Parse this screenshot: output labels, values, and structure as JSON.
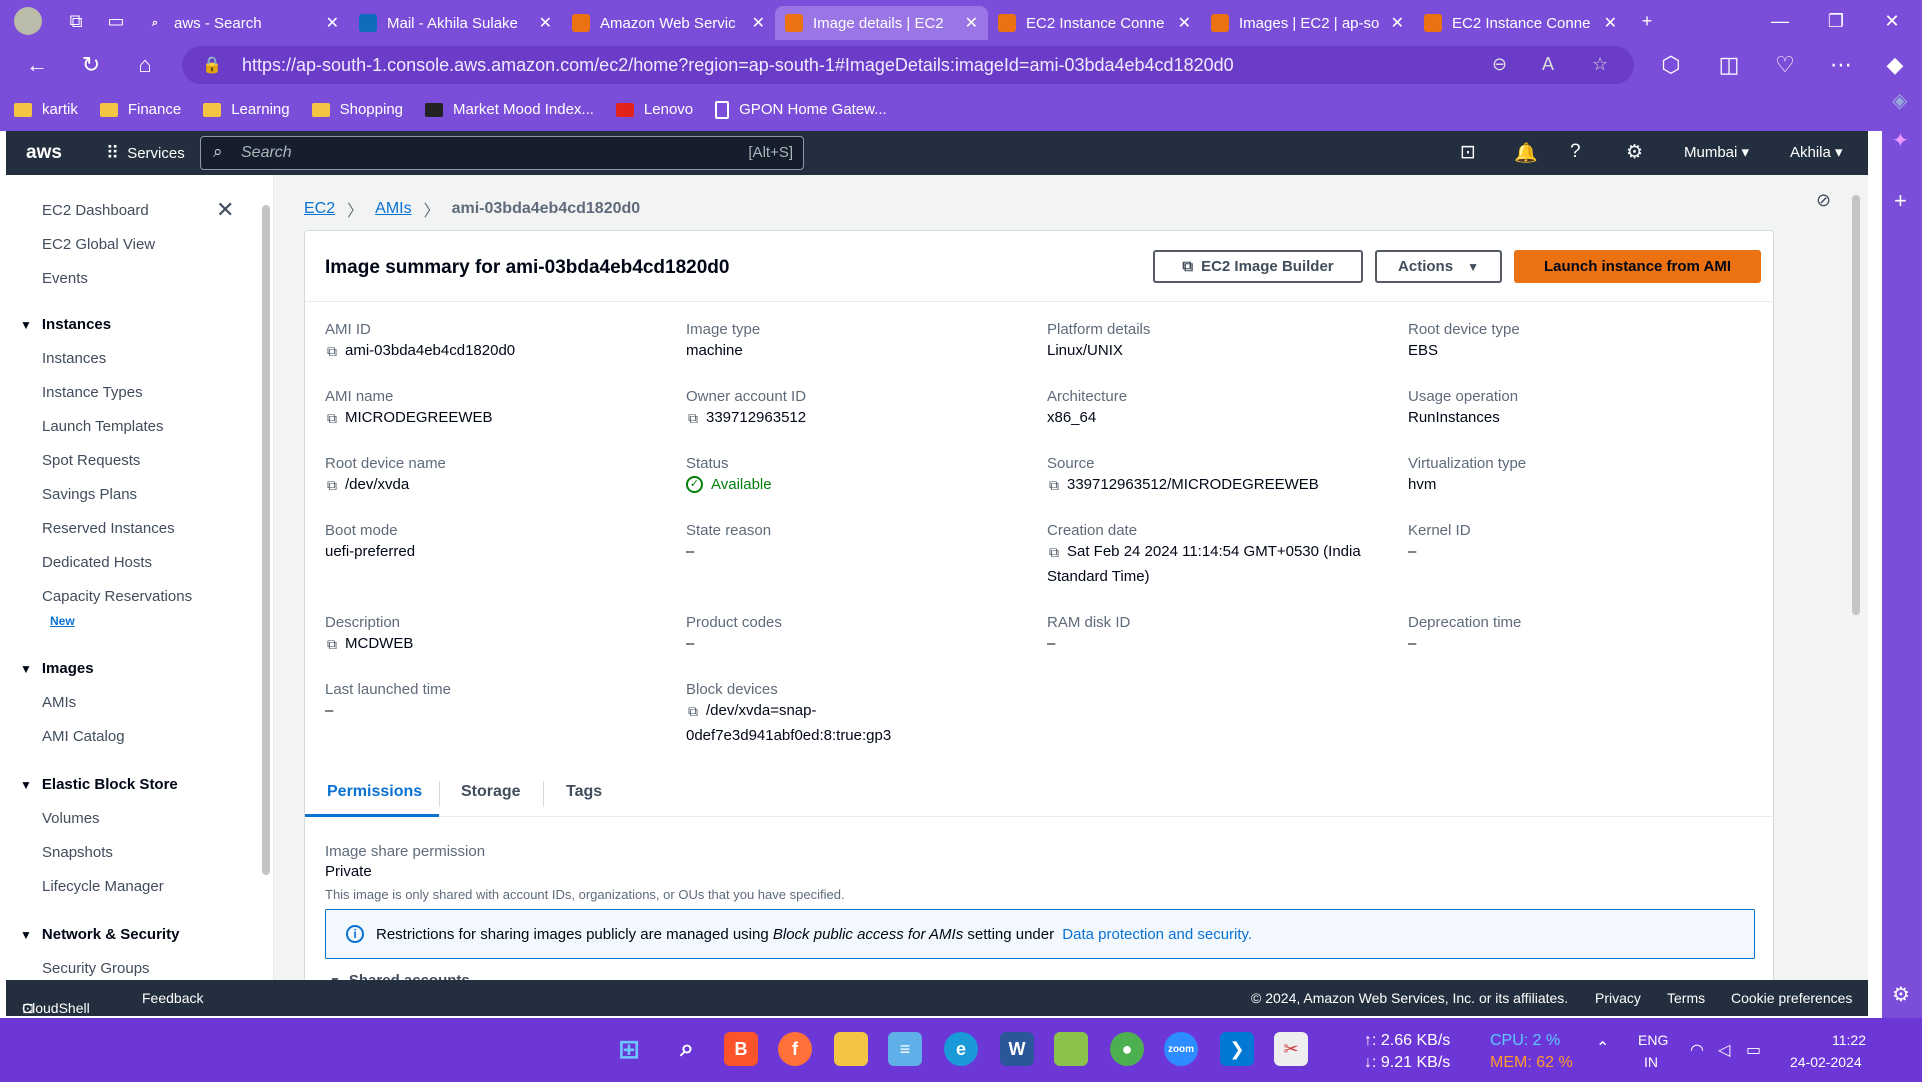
{
  "browser": {
    "tabs": [
      {
        "title": "aws - Search",
        "icon": "search-icon",
        "color": "#7b4ed9"
      },
      {
        "title": "Mail - Akhila Sulake",
        "icon": "outlook-icon",
        "color": "#0f6cbd"
      },
      {
        "title": "Amazon Web Servic",
        "icon": "aws-cube-icon",
        "color": "#ec7211"
      },
      {
        "title": "Image details | EC2",
        "icon": "ec2-icon",
        "color": "#ec7211",
        "active": true
      },
      {
        "title": "EC2 Instance Conne",
        "icon": "aws-cube-icon",
        "color": "#ec7211"
      },
      {
        "title": "Images | EC2 | ap-so",
        "icon": "ec2-icon",
        "color": "#ec7211"
      },
      {
        "title": "EC2 Instance Conne",
        "icon": "aws-cube-icon",
        "color": "#ec7211"
      }
    ],
    "url": "https://ap-south-1.console.aws.amazon.com/ec2/home?region=ap-south-1#ImageDetails:imageId=ami-03bda4eb4cd1820d0",
    "bookmarks": [
      "kartik",
      "Finance",
      "Learning",
      "Shopping",
      "Market Mood Index...",
      "Lenovo",
      "GPON Home Gatew..."
    ]
  },
  "aws_header": {
    "logo": "aws",
    "services": "Services",
    "search_placeholder": "Search",
    "search_shortcut": "[Alt+S]",
    "region": "Mumbai ▾",
    "user": "Akhila ▾"
  },
  "leftnav": {
    "dashboard": "EC2 Dashboard",
    "global_view": "EC2 Global View",
    "events": "Events",
    "instances_header": "Instances",
    "instances": [
      "Instances",
      "Instance Types",
      "Launch Templates",
      "Spot Requests",
      "Savings Plans",
      "Reserved Instances",
      "Dedicated Hosts",
      "Capacity Reservations"
    ],
    "new_badge": "New",
    "images_header": "Images",
    "images": [
      "AMIs",
      "AMI Catalog"
    ],
    "ebs_header": "Elastic Block Store",
    "ebs": [
      "Volumes",
      "Snapshots",
      "Lifecycle Manager"
    ],
    "netsec_header": "Network & Security",
    "netsec": [
      "Security Groups"
    ]
  },
  "breadcrumb": {
    "ec2": "EC2",
    "amis": "AMIs",
    "current": "ami-03bda4eb4cd1820d0"
  },
  "summary": {
    "title": "Image summary for ami-03bda4eb4cd1820d0",
    "btn_builder": "EC2 Image Builder",
    "btn_actions": "Actions",
    "btn_launch": "Launch instance from AMI",
    "fields": {
      "ami_id": {
        "label": "AMI ID",
        "value": "ami-03bda4eb4cd1820d0"
      },
      "image_type": {
        "label": "Image type",
        "value": "machine"
      },
      "platform": {
        "label": "Platform details",
        "value": "Linux/UNIX"
      },
      "root_type": {
        "label": "Root device type",
        "value": "EBS"
      },
      "ami_name": {
        "label": "AMI name",
        "value": "MICRODEGREEWEB"
      },
      "owner": {
        "label": "Owner account ID",
        "value": "339712963512"
      },
      "arch": {
        "label": "Architecture",
        "value": "x86_64"
      },
      "usage": {
        "label": "Usage operation",
        "value": "RunInstances"
      },
      "root_name": {
        "label": "Root device name",
        "value": "/dev/xvda"
      },
      "status": {
        "label": "Status",
        "value": "Available"
      },
      "source": {
        "label": "Source",
        "value": "339712963512/MICRODEGREEWEB"
      },
      "virt": {
        "label": "Virtualization type",
        "value": "hvm"
      },
      "boot": {
        "label": "Boot mode",
        "value": "uefi-preferred"
      },
      "state_reason": {
        "label": "State reason",
        "value": "–"
      },
      "created": {
        "label": "Creation date",
        "value1": "Sat Feb 24 2024 11:14:54 GMT+0530 (India",
        "value2": "Standard Time)"
      },
      "kernel": {
        "label": "Kernel ID",
        "value": "–"
      },
      "desc": {
        "label": "Description",
        "value": "MCDWEB"
      },
      "product": {
        "label": "Product codes",
        "value": "–"
      },
      "ramdisk": {
        "label": "RAM disk ID",
        "value": "–"
      },
      "deprec": {
        "label": "Deprecation time",
        "value": "–"
      },
      "last_launch": {
        "label": "Last launched time",
        "value": "–"
      },
      "block": {
        "label": "Block devices",
        "value1": "/dev/xvda=snap-",
        "value2": "0def7e3d941abf0ed:8:true:gp3"
      }
    }
  },
  "tabs": [
    "Permissions",
    "Storage",
    "Tags"
  ],
  "permissions": {
    "label": "Image share permission",
    "value": "Private",
    "note": "This image is only shared with account IDs, organizations, or OUs that you have specified.",
    "info_pre": "Restrictions for sharing images publicly are managed using ",
    "info_em": "Block public access for AMIs",
    "info_mid": " setting under ",
    "info_link": "Data protection and security.",
    "shared_accounts": "Shared accounts"
  },
  "footer": {
    "cloudshell": "CloudShell",
    "feedback": "Feedback",
    "copyright": "© 2024, Amazon Web Services, Inc. or its affiliates.",
    "privacy": "Privacy",
    "terms": "Terms",
    "cookies": "Cookie preferences"
  },
  "taskbar": {
    "up": "↑: 2.66 KB/s",
    "down": "↓: 9.21 KB/s",
    "cpu": "CPU: 2 %",
    "mem": "MEM: 62 %",
    "lang1": "ENG",
    "lang2": "IN",
    "time": "11:22",
    "date": "24-02-2024"
  }
}
